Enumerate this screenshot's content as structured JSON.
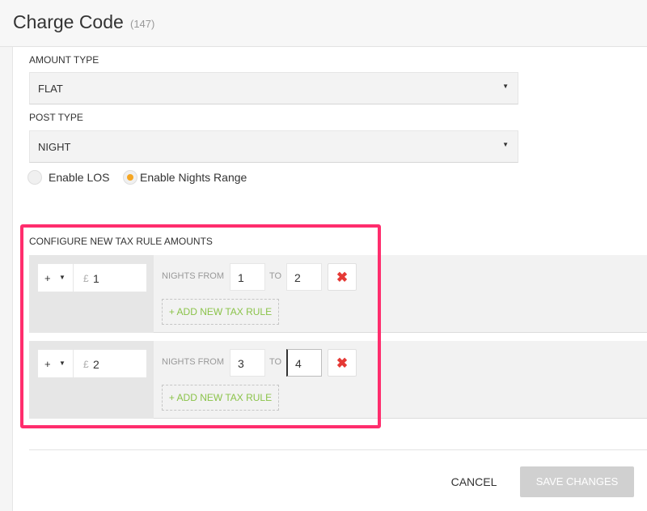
{
  "header": {
    "title": "Charge Code",
    "count": "(147)"
  },
  "amount_type": {
    "label": "AMOUNT TYPE",
    "value": "FLAT"
  },
  "post_type": {
    "label": "POST TYPE",
    "value": "NIGHT"
  },
  "options": {
    "enable_los": {
      "label": "Enable LOS",
      "checked": false
    },
    "enable_nights_range": {
      "label": "Enable Nights Range",
      "checked": true
    }
  },
  "tax_rules": {
    "title": "CONFIGURE NEW TAX RULE AMOUNTS",
    "nights_from_label": "NIGHTS FROM",
    "to_label": "TO",
    "add_label": "+ ADD NEW TAX RULE",
    "rows": [
      {
        "sign": "+",
        "currency": "£",
        "amount": "1",
        "from": "1",
        "to": "2"
      },
      {
        "sign": "+",
        "currency": "£",
        "amount": "2",
        "from": "3",
        "to": "4"
      }
    ]
  },
  "footer": {
    "cancel": "CANCEL",
    "save": "SAVE CHANGES"
  },
  "colors": {
    "highlight": "#ff2d6d",
    "radio_selected": "#f5a623",
    "add_link": "#8bc34a",
    "delete_icon": "#e53935"
  }
}
